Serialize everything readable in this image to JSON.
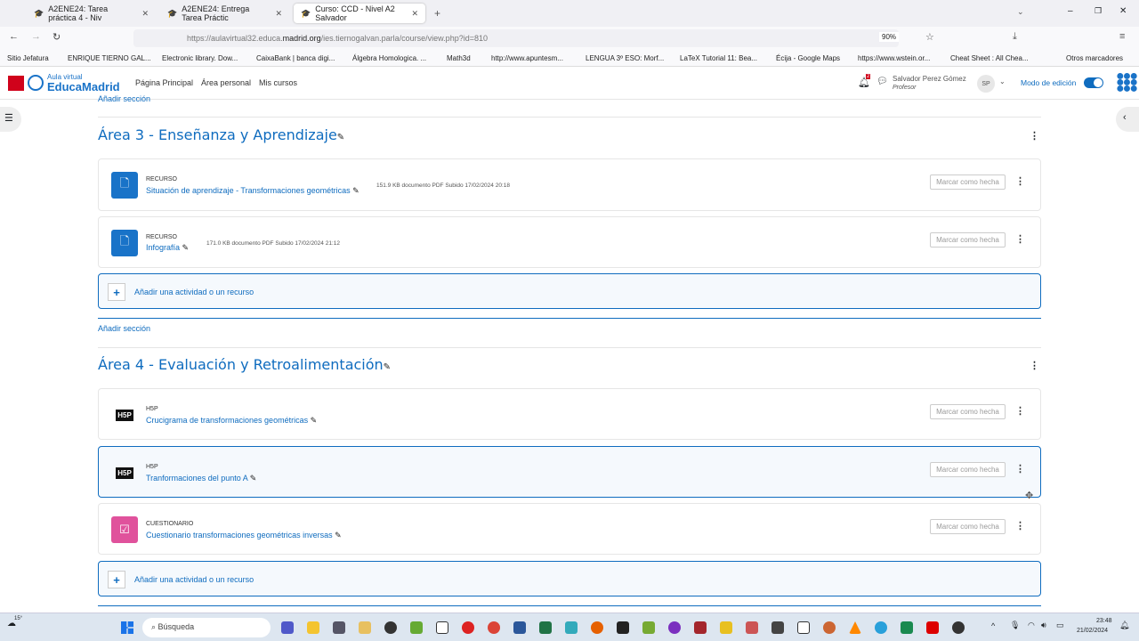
{
  "browser": {
    "tabs": [
      {
        "label": "A2ENE24: Tarea práctica 4 - Niv"
      },
      {
        "label": "A2ENE24: Entrega Tarea Práctic"
      },
      {
        "label": "Curso: CCD - Nivel A2 Salvador"
      }
    ],
    "url_prefix": "https://aulavirtual32.educa.",
    "url_domain": "madrid.org",
    "url_rest": "/ies.tiernogalvan.parla/course/view.php?id=810",
    "zoom": "90%",
    "bookmarks": [
      "Sitio Jefatura",
      "ENRIQUE TIERNO GAL...",
      "Electronic library. Dow...",
      "CaixaBank | banca digi...",
      "Álgebra Homologica. ...",
      "Math3d",
      "http://www.apuntesm...",
      "LENGUA 3º ESO: Morf...",
      "LaTeX Tutorial 11: Bea...",
      "Écija - Google Maps",
      "https://www.wstein.or...",
      "Cheat Sheet : All Chea...",
      "Otros marcadores"
    ]
  },
  "site": {
    "logo_top": "Aula virtual",
    "logo_main": "EducaMadrid",
    "nav": [
      "Página Principal",
      "Área personal",
      "Mis cursos"
    ],
    "notif_count": "2",
    "user_name": "Salvador Perez Gómez",
    "user_role": "Profesor",
    "avatar": "SP",
    "edit_mode": "Modo de edición",
    "edit_mode_on": true
  },
  "top_add_section": "Añadir sección",
  "sections": [
    {
      "title": "Área 3 - Enseñanza y Aprendizaje",
      "items": [
        {
          "type": "RECURSO",
          "name": "Situación de aprendizaje - Transformaciones geométricas",
          "meta": "151.9 KB documento PDF Subido 17/02/2024 20:18",
          "mark": "Marcar como hecha",
          "icon": "file-icon"
        },
        {
          "type": "RECURSO",
          "name": "Infografía",
          "meta": "171.0 KB documento PDF Subido 17/02/2024 21:12",
          "mark": "Marcar como hecha",
          "icon": "file-icon"
        }
      ],
      "add": "Añadir una actividad o un recurso",
      "add_section": "Añadir sección"
    },
    {
      "title": "Área 4 - Evaluación y Retroalimentación",
      "items": [
        {
          "type": "H5P",
          "name": "Crucigrama de transformaciones geométricas",
          "mark": "Marcar como hecha",
          "icon": "h5p-icon"
        },
        {
          "type": "H5P",
          "name": "Tranformaciones del punto A",
          "mark": "Marcar como hecha",
          "icon": "h5p-icon"
        },
        {
          "type": "CUESTIONARIO",
          "name": "Cuestionario transformaciones geométricas inversas",
          "mark": "Marcar como hecha",
          "icon": "quiz-icon"
        }
      ],
      "add": "Añadir una actividad o un recurso"
    }
  ],
  "taskbar": {
    "weather": "15°",
    "search": "Búsqueda",
    "time": "23:48",
    "date": "21/02/2024"
  }
}
